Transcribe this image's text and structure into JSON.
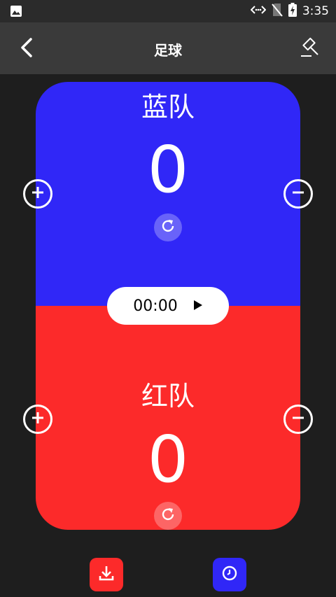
{
  "status_bar": {
    "time": "3:35",
    "icons": [
      "image-icon",
      "data-arrows-icon",
      "no-signal-icon",
      "battery-charging-icon"
    ]
  },
  "app_bar": {
    "title": "足球",
    "back_icon": "back-arrow-icon",
    "right_icon": "gavel-icon"
  },
  "blue_team": {
    "name": "蓝队",
    "score": "0",
    "color": "#3027f7"
  },
  "red_team": {
    "name": "红队",
    "score": "0",
    "color": "#fc2a2a"
  },
  "timer": {
    "time": "00:00",
    "icon": "play-icon"
  },
  "bottom_actions": [
    {
      "icon": "download-icon",
      "color": "#fc2a2a"
    },
    {
      "icon": "clock-icon",
      "color": "#3027f7"
    }
  ]
}
